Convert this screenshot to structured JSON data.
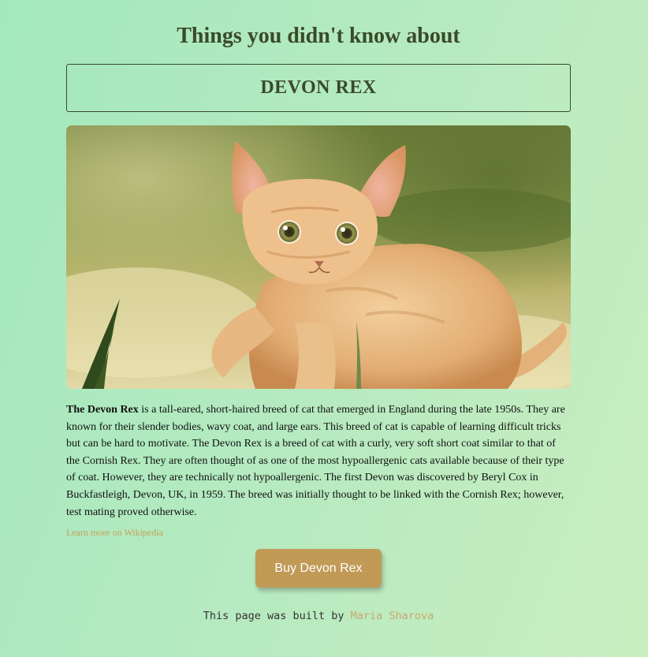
{
  "header": {
    "title": "Things you didn't know about",
    "breed_name": "DEVON REX"
  },
  "hero_image": {
    "subject": "devon-rex-kitten-photo"
  },
  "article": {
    "lead_bold": "The Devon Rex",
    "body": " is a tall-eared, short-haired breed of cat that emerged in England during the late 1950s. They are known for their slender bodies, wavy coat, and large ears. This breed of cat is capable of learning difficult tricks but can be hard to motivate. The Devon Rex is a breed of cat with a curly, very soft short coat similar to that of the Cornish Rex. They are often thought of as one of the most hypoallergenic cats available because of their type of coat. However, they are technically not hypoallergenic. The first Devon was discovered by Beryl Cox in Buckfastleigh, Devon, UK, in 1959. The breed was initially thought to be linked with the Cornish Rex; however, test mating proved otherwise.",
    "wiki_link_label": "Learn more on Wikipedia"
  },
  "actions": {
    "buy_label": "Buy Devon Rex"
  },
  "footer": {
    "prefix": "This page was built by ",
    "author": "Maria Sharova"
  },
  "colors": {
    "title": "#3a4a28",
    "button": "#c19a56",
    "link": "#c89e5a",
    "author": "#c8a86e"
  }
}
